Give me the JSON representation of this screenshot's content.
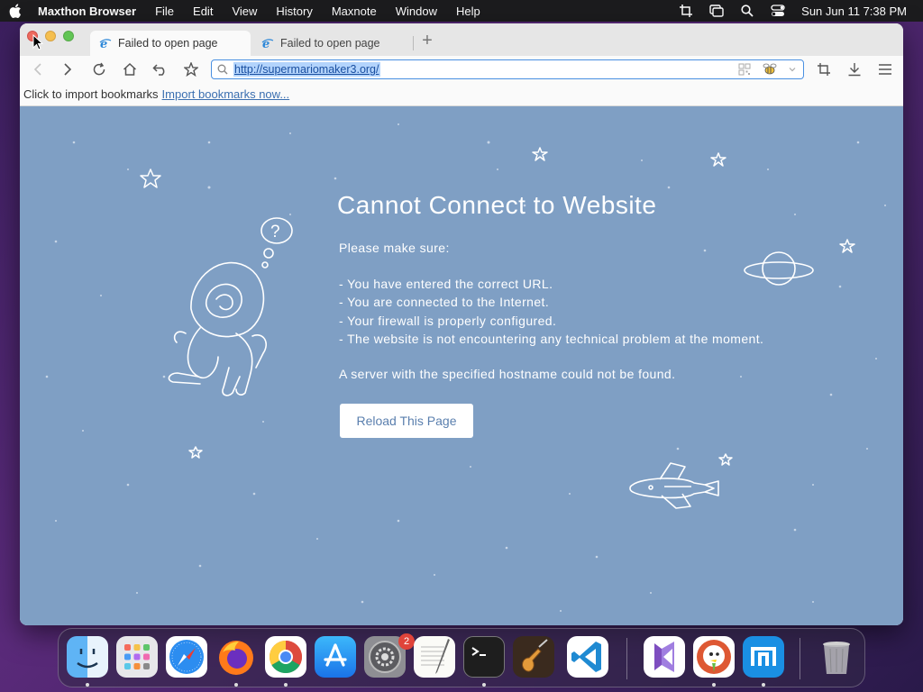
{
  "menubar": {
    "app_name": "Maxthon Browser",
    "items": [
      "File",
      "Edit",
      "View",
      "History",
      "Maxnote",
      "Window",
      "Help"
    ],
    "clock": "Sun Jun 11  7:38 PM"
  },
  "tabs": [
    {
      "title": "Failed to open page",
      "active": true
    },
    {
      "title": "Failed to open page",
      "active": false
    }
  ],
  "toolbar": {
    "url": "http://supermariomaker3.org/"
  },
  "bookmarks_bar": {
    "prompt": "Click to import bookmarks",
    "link": "Import bookmarks now..."
  },
  "error_page": {
    "title": "Cannot Connect to Website",
    "please_make_sure": "Please make sure:",
    "checklist": [
      "- You have entered the correct URL.",
      "- You are connected to the Internet.",
      "- Your firewall is properly configured.",
      "- The website is not encountering any technical problem at the moment."
    ],
    "server_message": "A server with the specified hostname could not be found.",
    "reload_label": "Reload This Page",
    "thought_bubble": "?"
  },
  "dock": {
    "apps": [
      "Finder",
      "Launchpad",
      "Safari",
      "Firefox",
      "Chrome",
      "App Store",
      "System Preferences",
      "TextEdit",
      "Terminal",
      "GarageBand",
      "Visual Studio Code",
      "Visual Studio",
      "DuckDuckGo",
      "Maxthon",
      "Trash"
    ],
    "system_preferences_badge": "2"
  },
  "colors": {
    "error_background": "#7f9fc4",
    "reload_text": "#5a7fae",
    "url_highlight": "#b3d4fc"
  }
}
